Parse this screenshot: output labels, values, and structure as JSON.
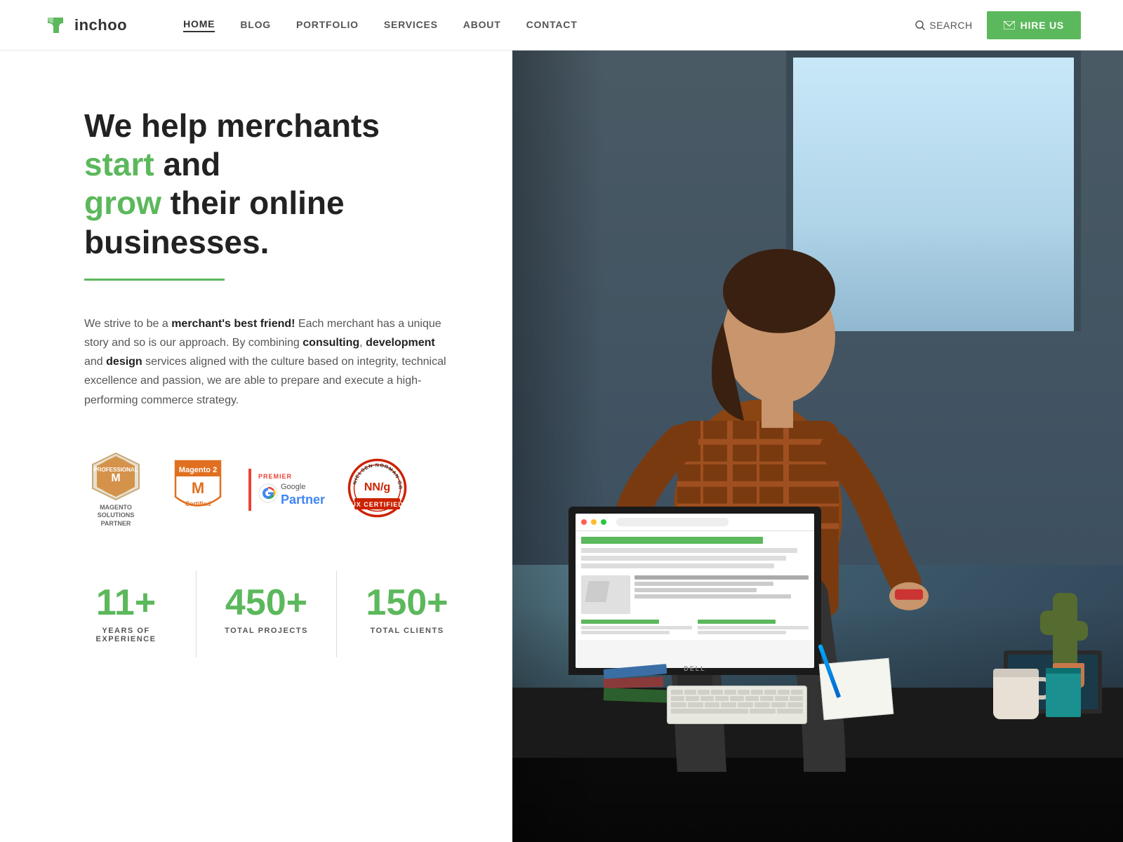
{
  "header": {
    "logo_text": "inchoo",
    "nav_items": [
      {
        "label": "HOME",
        "active": true
      },
      {
        "label": "BLOG",
        "active": false
      },
      {
        "label": "PORTFOLIO",
        "active": false
      },
      {
        "label": "SERVICES",
        "active": false
      },
      {
        "label": "ABOUT",
        "active": false
      },
      {
        "label": "CONTACT",
        "active": false
      }
    ],
    "search_label": "SEARCH",
    "hire_us_label": "HIRE US"
  },
  "hero": {
    "title_part1": "We help merchants ",
    "title_green1": "start",
    "title_part2": " and ",
    "title_green2": "grow",
    "title_part3": " their online businesses.",
    "description_part1": "We strive to be a ",
    "description_bold1": "merchant's best friend!",
    "description_part2": " Each merchant has a unique story and so is our approach. By combining ",
    "description_bold2": "consulting",
    "description_part3": ", ",
    "description_bold3": "development",
    "description_part4": " and ",
    "description_bold4": "design",
    "description_part5": " services aligned with the culture based on integrity, technical excellence and passion, we are able to prepare and execute a high-performing commerce strategy."
  },
  "badges": [
    {
      "id": "magento-pro",
      "label": "MAGENTO\nSOLUTIONS\nPARTNER",
      "type": "magento-pro"
    },
    {
      "id": "magento2",
      "label": "Magento 2\nCertified",
      "type": "magento2"
    },
    {
      "id": "google-partner",
      "label": "Google Partner",
      "type": "google"
    },
    {
      "id": "nng",
      "label": "UX CERTIFIED",
      "type": "nng"
    }
  ],
  "stats": [
    {
      "number": "11+",
      "label": "YEARS OF EXPERIENCE"
    },
    {
      "number": "450+",
      "label": "TOTAL PROJECTS"
    },
    {
      "number": "150+",
      "label": "TOTAL CLIENTS"
    }
  ],
  "colors": {
    "green": "#5cb85c",
    "dark": "#222222",
    "orange": "#e07020"
  }
}
